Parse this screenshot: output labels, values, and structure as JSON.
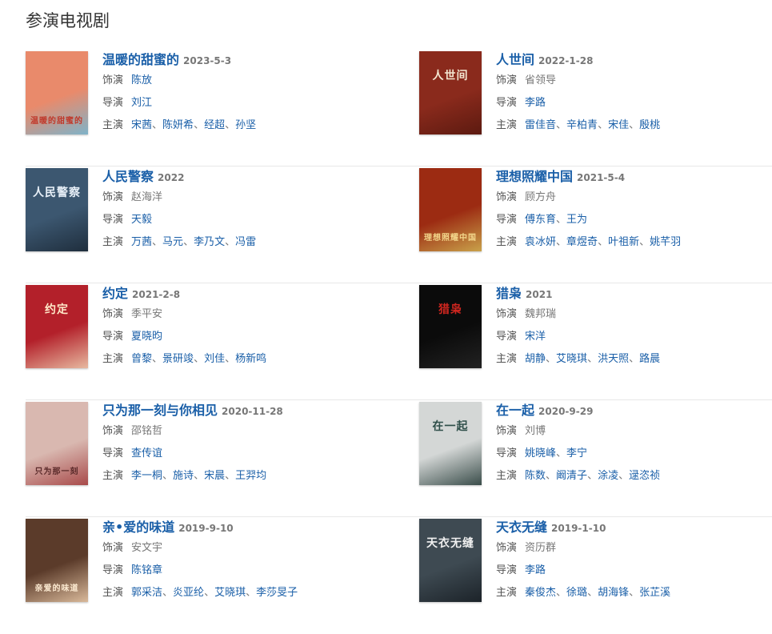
{
  "section_title": "参演电视剧",
  "labels": {
    "role": "饰演",
    "director": "导演",
    "cast": "主演"
  },
  "separator": "、",
  "shows": [
    {
      "title": "温暖的甜蜜的",
      "date": "2023-5-3",
      "role": "陈放",
      "role_is_link": true,
      "directors": [
        "刘江"
      ],
      "cast": [
        "宋茜",
        "陈妍希",
        "经超",
        "孙坚"
      ],
      "poster": {
        "bg": "#e98a6b",
        "accent": "#7fb3c9",
        "text": "温暖的甜蜜的",
        "text_color": "#c0392b"
      }
    },
    {
      "title": "人世间",
      "date": "2022-1-28",
      "role": "省领导",
      "role_is_link": false,
      "directors": [
        "李路"
      ],
      "cast": [
        "雷佳音",
        "辛柏青",
        "宋佳",
        "殷桃"
      ],
      "poster": {
        "bg": "#8a2a1c",
        "accent": "#5c1a10",
        "text": "人世间",
        "text_color": "#f3e6d0"
      }
    },
    {
      "title": "人民警察",
      "date": "2022",
      "role": "赵海洋",
      "role_is_link": false,
      "directors": [
        "天毅"
      ],
      "cast": [
        "万茜",
        "马元",
        "李乃文",
        "冯雷"
      ],
      "poster": {
        "bg": "#3c5770",
        "accent": "#1f2e3d",
        "text": "人民警察",
        "text_color": "#e8f0f8"
      }
    },
    {
      "title": "理想照耀中国",
      "date": "2021-5-4",
      "role": "顾方舟",
      "role_is_link": false,
      "directors": [
        "傅东育",
        "王为"
      ],
      "cast": [
        "袁冰妍",
        "章煜奇",
        "叶祖新",
        "姚芊羽"
      ],
      "poster": {
        "bg": "#9c2b12",
        "accent": "#c9a24a",
        "text": "理想照耀中国",
        "text_color": "#f2d58a"
      }
    },
    {
      "title": "约定",
      "date": "2021-2-8",
      "role": "季平安",
      "role_is_link": false,
      "directors": [
        "夏晓昀"
      ],
      "cast": [
        "曾黎",
        "景研竣",
        "刘佳",
        "杨新鸣"
      ],
      "poster": {
        "bg": "#b3202a",
        "accent": "#e7b9a0",
        "text": "约定",
        "text_color": "#ffe9c9"
      }
    },
    {
      "title": "猎枭",
      "date": "2021",
      "role": "魏邦瑞",
      "role_is_link": false,
      "directors": [
        "宋洋"
      ],
      "cast": [
        "胡静",
        "艾晓琪",
        "洪天照",
        "路晨"
      ],
      "poster": {
        "bg": "#0b0b0b",
        "accent": "#222222",
        "text": "猎枭",
        "text_color": "#d0261f"
      }
    },
    {
      "title": "只为那一刻与你相见",
      "date": "2020-11-28",
      "role": "邵铭哲",
      "role_is_link": false,
      "directors": [
        "查传谊"
      ],
      "cast": [
        "李一桐",
        "施诗",
        "宋晨",
        "王羿均"
      ],
      "poster": {
        "bg": "#d9b8b0",
        "accent": "#a84a4a",
        "text": "只为那一刻",
        "text_color": "#5a2a2a"
      }
    },
    {
      "title": "在一起",
      "date": "2020-9-29",
      "role": "刘博",
      "role_is_link": false,
      "directors": [
        "姚晓峰",
        "李宁"
      ],
      "cast": [
        "陈数",
        "阚清子",
        "涂凌",
        "逯恣祯"
      ],
      "poster": {
        "bg": "#d4d7d6",
        "accent": "#3a4d4a",
        "text": "在一起",
        "text_color": "#2f4f4a"
      }
    },
    {
      "title": "亲•爱的味道",
      "date": "2019-9-10",
      "role": "安文宇",
      "role_is_link": false,
      "directors": [
        "陈铭章"
      ],
      "cast": [
        "郭采洁",
        "炎亚纶",
        "艾晓琪",
        "李莎旻子"
      ],
      "poster": {
        "bg": "#5b3b2a",
        "accent": "#d9b99a",
        "text": "亲爱的味道",
        "text_color": "#fbe9d0"
      }
    },
    {
      "title": "天衣无缝",
      "date": "2019-1-10",
      "role": "资历群",
      "role_is_link": false,
      "directors": [
        "李路"
      ],
      "cast": [
        "秦俊杰",
        "徐璐",
        "胡海锋",
        "张芷溪"
      ],
      "poster": {
        "bg": "#3e4a52",
        "accent": "#1c2329",
        "text": "天衣无缝",
        "text_color": "#f0f0f0"
      }
    }
  ]
}
